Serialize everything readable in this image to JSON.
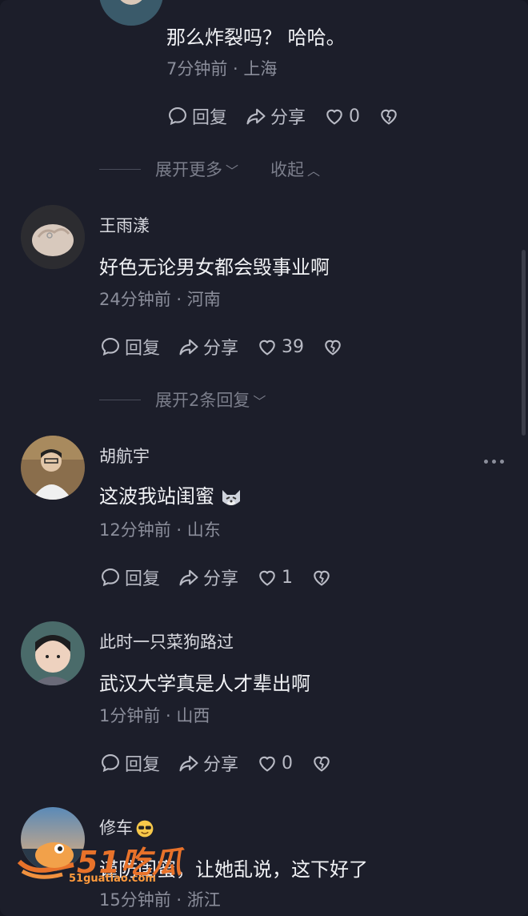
{
  "comments": [
    {
      "username": "",
      "content": "那么炸裂吗？ 哈哈。",
      "meta": "7分钟前 · 上海",
      "reply_label": "回复",
      "share_label": "分享",
      "likes": "0"
    },
    {
      "username": "王雨漾",
      "content": "好色无论男女都会毁事业啊",
      "meta": "24分钟前 · 河南",
      "reply_label": "回复",
      "share_label": "分享",
      "likes": "39"
    },
    {
      "username": "胡航宇",
      "content": "这波我站闺蜜",
      "meta": "12分钟前 · 山东",
      "reply_label": "回复",
      "share_label": "分享",
      "likes": "1"
    },
    {
      "username": "此时一只菜狗路过",
      "content": "武汉大学真是人才辈出啊",
      "meta": "1分钟前 · 山西",
      "reply_label": "回复",
      "share_label": "分享",
      "likes": "0"
    },
    {
      "username": "修车",
      "content": "谨防闺蜜，让她乱说，这下好了",
      "meta": "15分钟前 · 浙江"
    }
  ],
  "expand_1": {
    "more_label": "展开更多",
    "collapse_label": "收起"
  },
  "expand_2": {
    "more_label": "展开2条回复"
  },
  "watermark": {
    "brand": "51吃瓜",
    "url": "51guatiao.com"
  },
  "icons": {
    "reply": "comment-bubble-icon",
    "share": "share-arrow-icon",
    "like": "heart-icon",
    "dislike": "broken-heart-icon",
    "more": "more-dots-icon"
  },
  "colors": {
    "background": "#1c1e2a",
    "text_primary": "#f1f2f5",
    "text_secondary": "#8b8e9b",
    "watermark": "#e8722a"
  }
}
